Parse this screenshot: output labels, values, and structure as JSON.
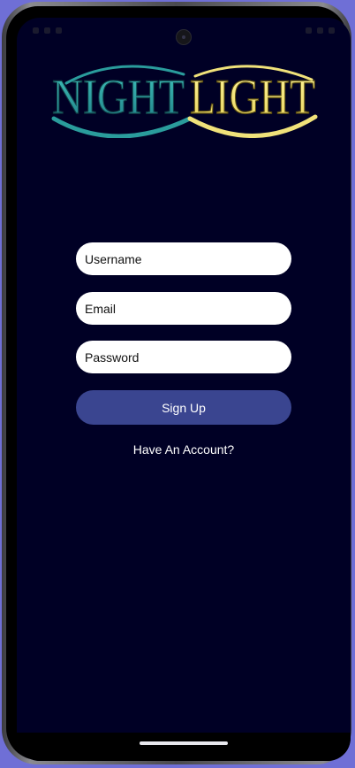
{
  "app": {
    "logo_text": "NIGHTLIGHT",
    "logo_part1": "NIGHT",
    "logo_part2": "LIGHT"
  },
  "form": {
    "username_placeholder": "Username",
    "email_placeholder": "Email",
    "password_placeholder": "Password",
    "signup_label": "Sign Up",
    "have_account_label": "Have An Account?"
  },
  "colors": {
    "background": "#000025",
    "logo_night": "#2a9c9c",
    "logo_light": "#f0e27a",
    "button": "#3a4590",
    "field": "#ffffff"
  }
}
